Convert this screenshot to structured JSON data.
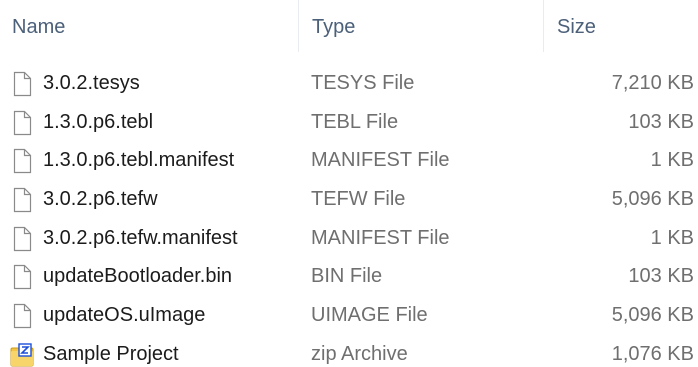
{
  "columns": {
    "name": "Name",
    "type": "Type",
    "size": "Size"
  },
  "files": [
    {
      "name": "3.0.2.tesys",
      "type": "TESYS File",
      "size": "7,210 KB",
      "icon": "document-icon"
    },
    {
      "name": "1.3.0.p6.tebl",
      "type": "TEBL File",
      "size": "103 KB",
      "icon": "document-icon"
    },
    {
      "name": "1.3.0.p6.tebl.manifest",
      "type": "MANIFEST File",
      "size": "1 KB",
      "icon": "document-icon"
    },
    {
      "name": "3.0.2.p6.tefw",
      "type": "TEFW File",
      "size": "5,096 KB",
      "icon": "document-icon"
    },
    {
      "name": "3.0.2.p6.tefw.manifest",
      "type": "MANIFEST File",
      "size": "1 KB",
      "icon": "document-icon"
    },
    {
      "name": "updateBootloader.bin",
      "type": "BIN File",
      "size": "103 KB",
      "icon": "document-icon"
    },
    {
      "name": "updateOS.uImage",
      "type": "UIMAGE File",
      "size": "5,096 KB",
      "icon": "document-icon"
    },
    {
      "name": "Sample Project",
      "type": "zip Archive",
      "size": "1,076 KB",
      "icon": "zip-archive-icon"
    }
  ],
  "colors": {
    "header_text": "#4c607a",
    "name_text": "#1b1b1b",
    "detail_text": "#6f6f6f",
    "zip_folder": "#f4c542",
    "zip_badge": "#1d4fd8"
  }
}
